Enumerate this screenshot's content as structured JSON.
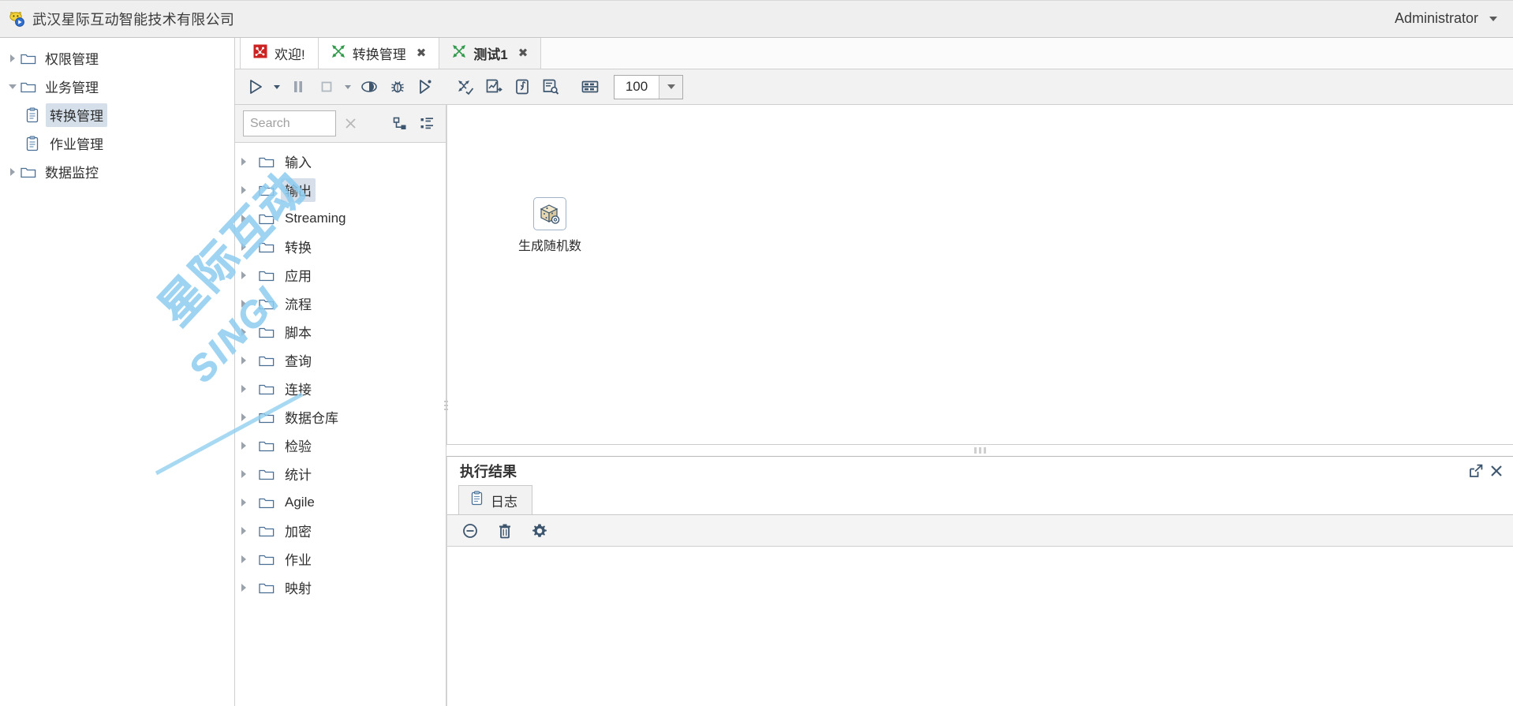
{
  "topbar": {
    "logo_icon": "company-logo-icon",
    "title": "武汉星际互动智能技术有限公司",
    "user": "Administrator",
    "user_caret_icon": "chevron-down-icon"
  },
  "nav": {
    "items": [
      {
        "label": "权限管理",
        "icon": "folder-icon",
        "twisty": "collapsed",
        "level": 0,
        "selected": false
      },
      {
        "label": "业务管理",
        "icon": "folder-icon",
        "twisty": "expanded",
        "level": 0,
        "selected": false
      },
      {
        "label": "转换管理",
        "icon": "document-icon",
        "twisty": "none",
        "level": 1,
        "selected": true
      },
      {
        "label": "作业管理",
        "icon": "document-icon",
        "twisty": "none",
        "level": 1,
        "selected": false
      },
      {
        "label": "数据监控",
        "icon": "folder-icon",
        "twisty": "collapsed",
        "level": 0,
        "selected": false
      }
    ]
  },
  "tabs": [
    {
      "label": "欢迎!",
      "icon": "welcome-icon",
      "closable": false,
      "active": false
    },
    {
      "label": "转换管理",
      "icon": "transform-icon",
      "closable": true,
      "active": false
    },
    {
      "label": "测试1",
      "icon": "transform-icon",
      "closable": true,
      "active": true
    }
  ],
  "toolbar": {
    "buttons": [
      {
        "name": "run-button",
        "icon": "play-icon",
        "caret": true
      },
      {
        "name": "pause-button",
        "icon": "pause-icon",
        "caret": false
      },
      {
        "name": "stop-button",
        "icon": "stop-icon",
        "caret": true
      },
      {
        "name": "preview-button",
        "icon": "eye-icon",
        "caret": false
      },
      {
        "name": "debug-button",
        "icon": "bug-icon",
        "caret": false
      },
      {
        "name": "run-step-button",
        "icon": "play-outline-icon",
        "caret": false
      },
      {
        "name": "verify-transform-button",
        "icon": "verify-icon",
        "caret": false
      },
      {
        "name": "analyze-impact-button",
        "icon": "impact-analysis-icon",
        "caret": false
      },
      {
        "name": "sql-button",
        "icon": "sql-icon",
        "caret": false
      },
      {
        "name": "database-explore-button",
        "icon": "db-search-icon",
        "caret": false
      },
      {
        "name": "grid-button",
        "icon": "grid-icon",
        "caret": false
      }
    ],
    "zoom_value": "100",
    "zoom_caret_icon": "chevron-down-icon"
  },
  "palette": {
    "search": {
      "value": "",
      "placeholder": "Search"
    },
    "clear_icon": "clear-x-icon",
    "expand_icon": "tree-expand-icon",
    "collapse_icon": "tree-collapse-icon",
    "items": [
      {
        "label": "输入",
        "twisty": "collapsed",
        "selected": false
      },
      {
        "label": "输出",
        "twisty": "collapsed",
        "selected": true
      },
      {
        "label": "Streaming",
        "twisty": "collapsed",
        "selected": false
      },
      {
        "label": "转换",
        "twisty": "collapsed",
        "selected": false
      },
      {
        "label": "应用",
        "twisty": "collapsed",
        "selected": false
      },
      {
        "label": "流程",
        "twisty": "collapsed",
        "selected": false
      },
      {
        "label": "脚本",
        "twisty": "collapsed",
        "selected": false
      },
      {
        "label": "查询",
        "twisty": "collapsed",
        "selected": false
      },
      {
        "label": "连接",
        "twisty": "collapsed",
        "selected": false
      },
      {
        "label": "数据仓库",
        "twisty": "collapsed",
        "selected": false
      },
      {
        "label": "检验",
        "twisty": "collapsed",
        "selected": false
      },
      {
        "label": "统计",
        "twisty": "collapsed",
        "selected": false
      },
      {
        "label": "Agile",
        "twisty": "collapsed",
        "selected": false
      },
      {
        "label": "加密",
        "twisty": "collapsed",
        "selected": false
      },
      {
        "label": "作业",
        "twisty": "collapsed",
        "selected": false
      },
      {
        "label": "映射",
        "twisty": "collapsed",
        "selected": false
      }
    ]
  },
  "canvas": {
    "nodes": [
      {
        "label": "生成随机数",
        "icon": "random-number-generator-icon"
      }
    ]
  },
  "watermark": {
    "line1": "星际互动",
    "line2": "SINGI",
    "color": "#8ecdf0"
  },
  "results": {
    "title": "执行结果",
    "maximize_icon": "external-link-icon",
    "close_icon": "close-icon",
    "tabs": [
      {
        "label": "日志",
        "icon": "log-icon",
        "active": true
      }
    ],
    "toolbar": [
      {
        "name": "collapse-log-button",
        "icon": "minus-circle-icon"
      },
      {
        "name": "clear-log-button",
        "icon": "trash-icon"
      },
      {
        "name": "log-settings-button",
        "icon": "gear-icon"
      }
    ],
    "log_lines": []
  },
  "colors": {
    "accent": "#3d566e",
    "selection": "#d5dfe9",
    "tab_icon_green": "#2e9a4a",
    "welcome_icon_red": "#cc2222",
    "chrome": "#f2f2f2"
  }
}
